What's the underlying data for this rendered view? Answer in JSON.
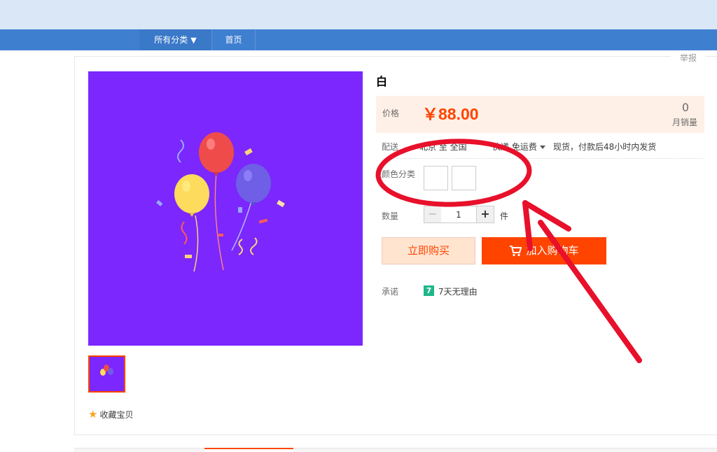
{
  "nav": {
    "category_label": "所有分类",
    "category_arrow": "▼",
    "home_label": "首页"
  },
  "report_label": "举报",
  "product": {
    "title": "白",
    "price_label": "价格",
    "price": "￥88.00",
    "sales_count": "0",
    "sales_label": "月销量",
    "shipping_label": "配送",
    "shipping_from": "北京 至 全国",
    "shipping_method": "快递 免运费",
    "shipping_note": "现货，付款后48小时内发货",
    "color_label": "颜色分类",
    "quantity_label": "数量",
    "quantity_value": "1",
    "quantity_minus": "−",
    "quantity_plus": "+",
    "quantity_unit": "件",
    "buy_now_label": "立即购买",
    "add_cart_label": "加入购物车",
    "promise_label": "承诺",
    "promise_badge": "7",
    "promise_text": "7天无理由"
  },
  "favorite_label": "收藏宝贝",
  "colors": {
    "accent": "#ff4400",
    "image_bg": "#7b27fd",
    "nav": "#3f7fd0",
    "annotation": "#e8102a"
  }
}
